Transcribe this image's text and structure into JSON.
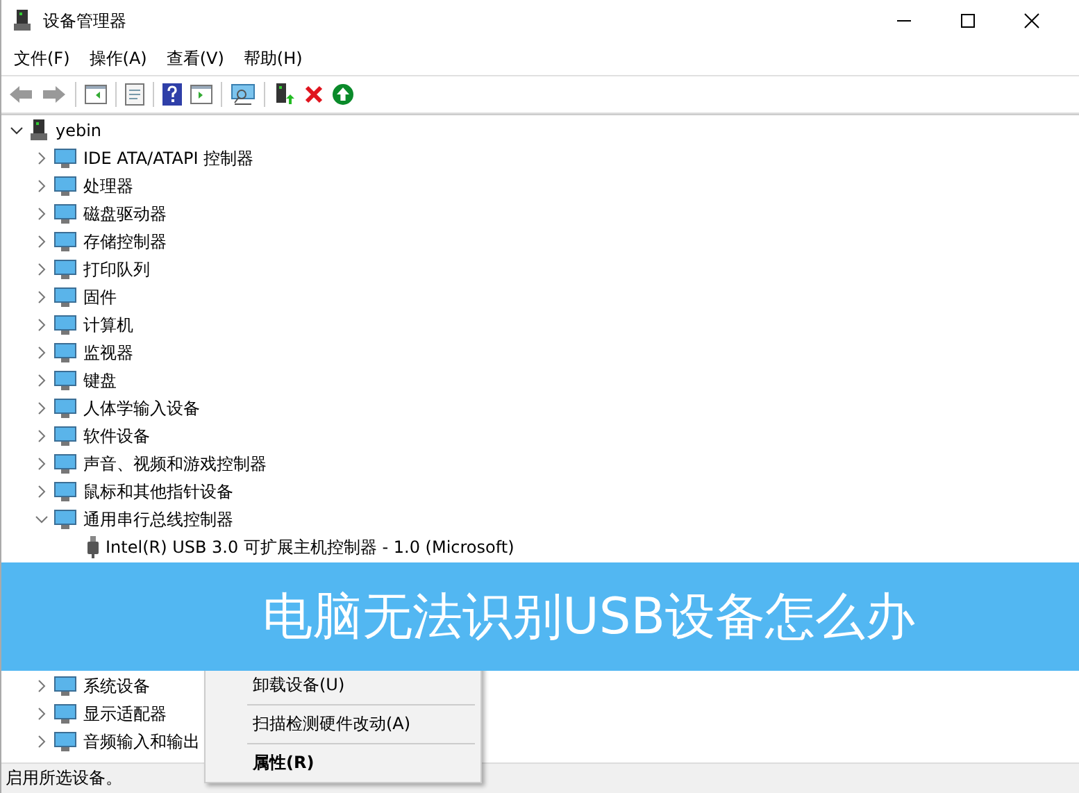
{
  "window": {
    "title": "设备管理器"
  },
  "menu_bar": [
    "文件(F)",
    "操作(A)",
    "查看(V)",
    "帮助(H)"
  ],
  "tree": {
    "label": "yebin",
    "expanded": true,
    "children": [
      {
        "label": "IDE ATA/ATAPI 控制器",
        "expanded": false
      },
      {
        "label": "处理器",
        "expanded": false
      },
      {
        "label": "磁盘驱动器",
        "expanded": false
      },
      {
        "label": "存储控制器",
        "expanded": false
      },
      {
        "label": "打印队列",
        "expanded": false
      },
      {
        "label": "固件",
        "expanded": false
      },
      {
        "label": "计算机",
        "expanded": false
      },
      {
        "label": "监视器",
        "expanded": false
      },
      {
        "label": "键盘",
        "expanded": false
      },
      {
        "label": "人体学输入设备",
        "expanded": false
      },
      {
        "label": "软件设备",
        "expanded": false
      },
      {
        "label": "声音、视频和游戏控制器",
        "expanded": false
      },
      {
        "label": "鼠标和其他指针设备",
        "expanded": false
      },
      {
        "label": "通用串行总线控制器",
        "expanded": true,
        "children": [
          {
            "label": "Intel(R) USB 3.0 可扩展主机控制器 - 1.0 (Microsoft)"
          }
        ]
      },
      {
        "label": "系统设备",
        "expanded": false
      },
      {
        "label": "显示适配器",
        "expanded": false
      },
      {
        "label": "音频输入和输出",
        "expanded": false
      }
    ]
  },
  "banner": {
    "title": "电脑无法识别USB设备怎么办"
  },
  "context_menu": [
    {
      "label": "卸载设备(U)",
      "bold": false
    },
    {
      "label": "扫描检测硬件改动(A)",
      "bold": false
    },
    {
      "label": "属性(R)",
      "bold": true
    }
  ],
  "status_bar": "启用所选设备。"
}
